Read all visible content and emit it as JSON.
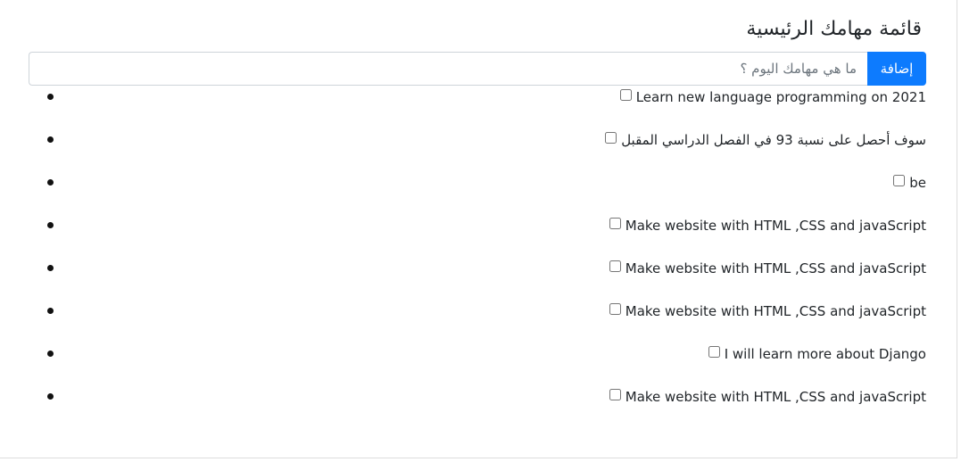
{
  "header": {
    "title": "قائمة مهامك الرئيسية"
  },
  "form": {
    "placeholder": "ما هي مهامك اليوم ؟",
    "value": "",
    "add_label": "إضافة"
  },
  "tasks": [
    {
      "text": "Learn new language programming on 2021",
      "checked": false
    },
    {
      "text": "سوف أحصل على نسبة 93 في الفصل الدراسي المقبل",
      "checked": false
    },
    {
      "text": "be",
      "checked": false
    },
    {
      "text": "Make website with HTML ,CSS and javaScript",
      "checked": false
    },
    {
      "text": "Make website with HTML ,CSS and javaScript",
      "checked": false
    },
    {
      "text": "Make website with HTML ,CSS and javaScript",
      "checked": false
    },
    {
      "text": "I will learn more about Django",
      "checked": false
    },
    {
      "text": "Make website with HTML ,CSS and javaScript",
      "checked": false
    }
  ],
  "colors": {
    "accent": "#0d7bfe",
    "text": "#212529",
    "border": "#ced4da"
  }
}
